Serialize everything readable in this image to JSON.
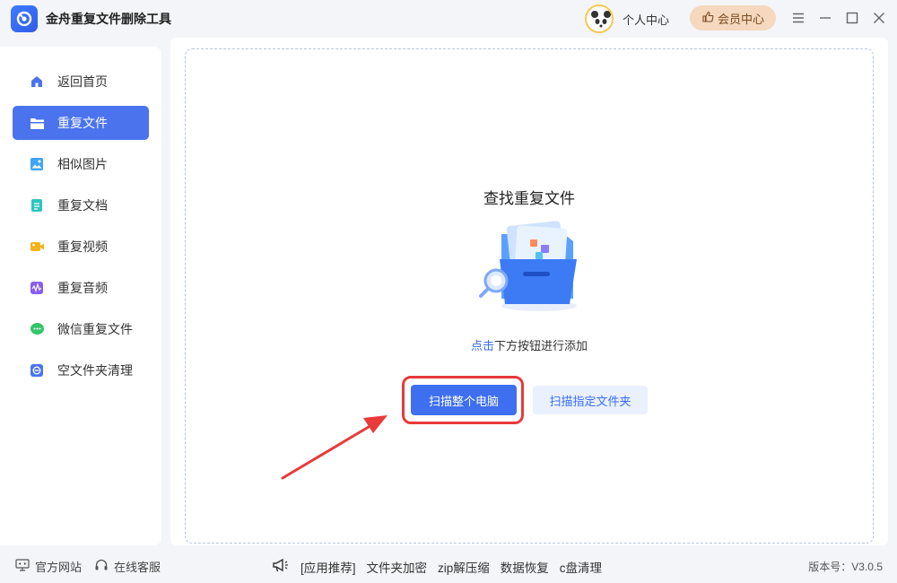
{
  "app": {
    "title": "金舟重复文件删除工具",
    "logo_icon": "app-logo-icon"
  },
  "header": {
    "user_center": "个人中心",
    "vip_center": "会员中心",
    "window_controls": [
      "menu-icon",
      "minimize-icon",
      "maximize-icon",
      "close-icon"
    ]
  },
  "sidebar": {
    "items": [
      {
        "label": "返回首页",
        "icon": "home-icon",
        "color": "#4a73ed",
        "active": false
      },
      {
        "label": "重复文件",
        "icon": "folder-icon",
        "color": "#ffffff",
        "active": true
      },
      {
        "label": "相似图片",
        "icon": "image-icon",
        "color": "#3fa4f4",
        "active": false
      },
      {
        "label": "重复文档",
        "icon": "document-icon",
        "color": "#2ec4c0",
        "active": false
      },
      {
        "label": "重复视频",
        "icon": "video-icon",
        "color": "#f6b21a",
        "active": false
      },
      {
        "label": "重复音频",
        "icon": "audio-icon",
        "color": "#8a5cf0",
        "active": false
      },
      {
        "label": "微信重复文件",
        "icon": "wechat-icon",
        "color": "#34c46a",
        "active": false
      },
      {
        "label": "空文件夹清理",
        "icon": "empty-folder-icon",
        "color": "#4a73ed",
        "active": false
      }
    ]
  },
  "main": {
    "title": "查找重复文件",
    "hint_link": "点击",
    "hint_rest": "下方按钮进行添加",
    "scan_all_button": "扫描整个电脑",
    "scan_folder_button": "扫描指定文件夹"
  },
  "footer": {
    "website": "官方网站",
    "support": "在线客服",
    "promo_label": "[应用推荐]",
    "promo_items": [
      "文件夹加密",
      "zip解压缩",
      "数据恢复",
      "c盘清理"
    ],
    "version": "版本号：V3.0.5"
  },
  "colors": {
    "accent": "#3e6ff0",
    "highlight": "#e83a3a",
    "vip": "#f5d8bd"
  }
}
